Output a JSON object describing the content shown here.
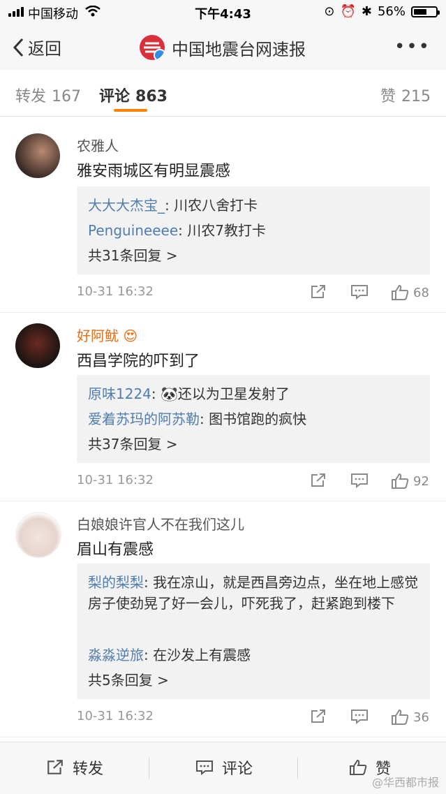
{
  "status_bar": {
    "carrier": "中国移动",
    "time": "下午4:43",
    "battery": "56%"
  },
  "nav": {
    "back_label": "返回",
    "title": "中国地震台网速报",
    "more": "•••"
  },
  "tabs": {
    "repost": {
      "label": "转发",
      "count": "167"
    },
    "comments": {
      "label": "评论",
      "count": "863"
    },
    "likes": {
      "label": "赞",
      "count": "215"
    }
  },
  "comments": [
    {
      "author": "农雅人",
      "text": "雅安雨城区有明显震感",
      "replies": [
        {
          "name": "大大大杰宝_",
          "text": ": 川农八舍打卡"
        },
        {
          "name": "Penguineeee",
          "text": ": 川农7教打卡"
        }
      ],
      "total": "共31条回复 >",
      "date": "10-31 16:32",
      "likes": "68"
    },
    {
      "author": "好阿鱿",
      "text": "西昌学院的吓到了",
      "replies": [
        {
          "name": "原味1224",
          "text": ": 🐼还以为卫星发射了"
        },
        {
          "name": "爱着苏玛的阿苏勒",
          "text": ": 图书馆跑的疯快"
        }
      ],
      "total": "共37条回复 >",
      "date": "10-31 16:32",
      "likes": "92"
    },
    {
      "author": "白娘娘许官人不在我们这儿",
      "text": "眉山有震感",
      "replies": [
        {
          "name": "梨的梨梨",
          "text": ": 我在凉山，就是西昌旁边点，坐在地上感觉房子使劲晃了好一会儿，吓死我了，赶紧跑到楼下"
        },
        {
          "name": "淼淼逆旅",
          "text": ": 在沙发上有震感"
        }
      ],
      "total": "共5条回复 >",
      "date": "10-31 16:32",
      "likes": "36"
    }
  ],
  "bottom_bar": {
    "repost": "转发",
    "comment": "评论",
    "like": "赞"
  },
  "watermark": "@华西都市报",
  "colors": {
    "accent": "#ff8200",
    "link": "#507daf",
    "author_highlight": "#e86d13"
  }
}
